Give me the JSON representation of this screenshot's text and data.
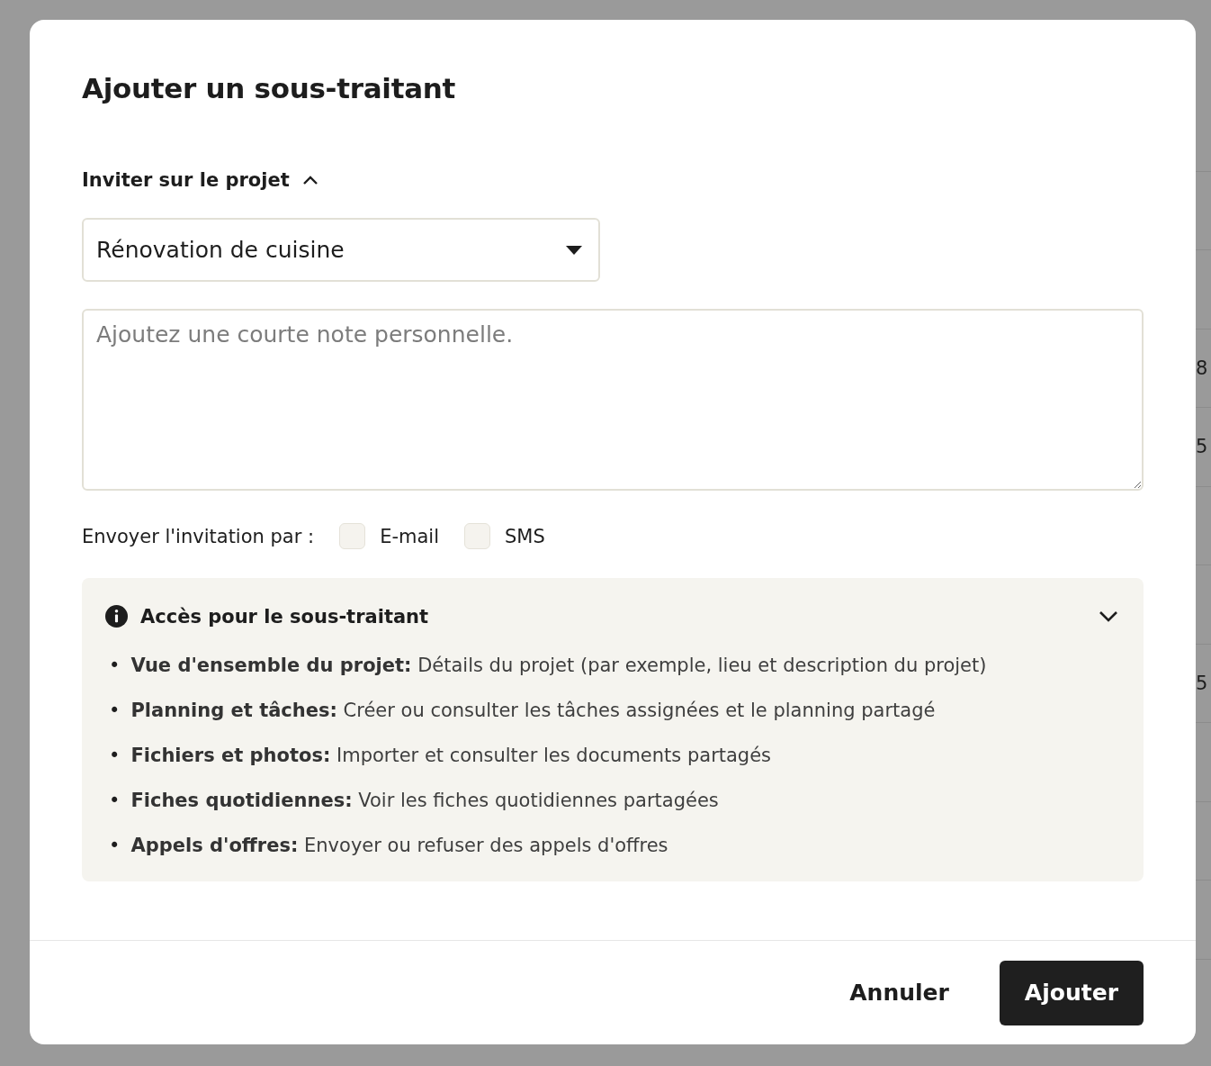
{
  "background_table": {
    "cells": [
      "",
      "",
      "",
      "8",
      "5",
      "",
      "",
      "5",
      "",
      "",
      ""
    ]
  },
  "dialog": {
    "title": "Ajouter un sous-traitant",
    "invite_section": {
      "label": "Inviter sur le projet",
      "expanded": true
    },
    "project_select": {
      "value": "Rénovation de cuisine"
    },
    "note": {
      "placeholder": "Ajoutez une courte note personnelle."
    },
    "send_by": {
      "label": "Envoyer l'invitation par :",
      "options": [
        {
          "label": "E-mail",
          "checked": false
        },
        {
          "label": "SMS",
          "checked": false
        }
      ]
    },
    "access_panel": {
      "title": "Accès pour le sous-traitant",
      "items": [
        {
          "bullet": "•",
          "text": "**Vue d'ensemble du projet:** Détails du projet (par exemple, lieu et description du projet)"
        },
        {
          "bullet": "•",
          "text": "**Planning et tâches:** Créer ou consulter les tâches assignées et le planning partagé"
        },
        {
          "bullet": "•",
          "text": "**Fichiers et photos:** Importer et consulter les documents partagés"
        },
        {
          "bullet": "•",
          "text": "**Fiches quotidiennes:** Voir les fiches quotidiennes partagées"
        },
        {
          "bullet": "•",
          "text": "**Appels d'offres:** Envoyer ou refuser des appels d'offres"
        }
      ]
    },
    "buttons": [
      {
        "label": "Annuler",
        "kind": "secondary"
      },
      {
        "label": "Ajouter",
        "kind": "primary"
      }
    ]
  }
}
